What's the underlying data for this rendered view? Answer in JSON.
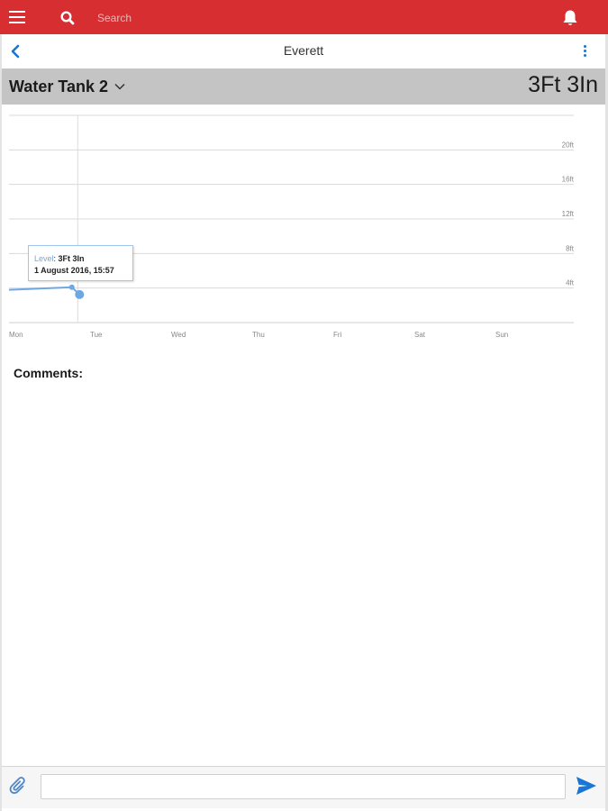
{
  "search": {
    "placeholder": "Search"
  },
  "nav": {
    "title": "Everett"
  },
  "tank": {
    "name": "Water Tank 2",
    "level": "3Ft 3In"
  },
  "chart_data": {
    "type": "line",
    "x": [
      "Mon",
      "Tue",
      "Wed",
      "Thu",
      "Fri",
      "Sat",
      "Sun"
    ],
    "y_ticks": [
      "4ft",
      "8ft",
      "12ft",
      "16ft",
      "20ft"
    ],
    "ylim": [
      0,
      24
    ],
    "series": [
      {
        "name": "Level",
        "color": "#6fa7e3",
        "points": [
          {
            "x": "Mon",
            "y": 3.8
          },
          {
            "x": "Mon 22:00",
            "y": 4.1
          },
          {
            "x": "1 August 2016, 15:57",
            "y": 3.25
          }
        ]
      }
    ],
    "tooltip": {
      "series": "Level",
      "value": "3Ft 3In",
      "timestamp": "1 August 2016, 15:57"
    },
    "grid": true
  },
  "comments": {
    "label": "Comments:"
  },
  "composer": {
    "placeholder": ""
  },
  "colors": {
    "brand": "#d62e31",
    "accent": "#1976d2",
    "series": "#6fa7e3"
  }
}
